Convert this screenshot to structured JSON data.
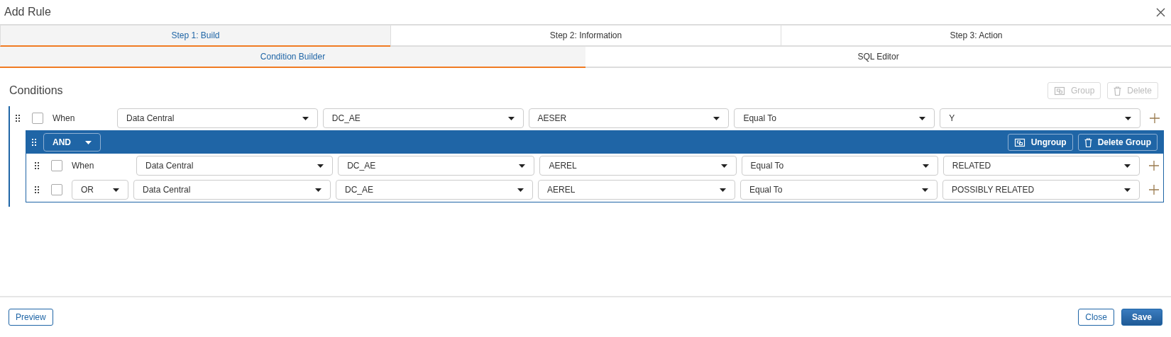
{
  "window": {
    "title": "Add Rule"
  },
  "steps": [
    {
      "label": "Step 1: Build",
      "selected": true
    },
    {
      "label": "Step 2: Information",
      "selected": false
    },
    {
      "label": "Step 3: Action",
      "selected": false
    }
  ],
  "sub_tabs": [
    {
      "label": "Condition Builder",
      "selected": true
    },
    {
      "label": "SQL Editor",
      "selected": false
    }
  ],
  "conditions": {
    "heading": "Conditions",
    "toolbar": [
      {
        "kind": "group",
        "label": "Group",
        "disabled": true
      },
      {
        "kind": "delete",
        "label": "Delete",
        "disabled": true
      }
    ],
    "rows": [
      {
        "checked": false,
        "connector": {
          "kind": "label",
          "text": "When"
        },
        "fields": [
          "Data Central",
          "DC_AE",
          "AESER",
          "Equal To",
          "Y"
        ]
      }
    ],
    "group": {
      "operator": "AND",
      "buttons": [
        {
          "kind": "ungroup",
          "label": "Ungroup"
        },
        {
          "kind": "delete",
          "label": "Delete Group"
        }
      ],
      "rows": [
        {
          "checked": false,
          "connector": {
            "kind": "label",
            "text": "When"
          },
          "fields": [
            "Data Central",
            "DC_AE",
            "AEREL",
            "Equal To",
            "RELATED"
          ]
        },
        {
          "checked": false,
          "connector": {
            "kind": "select",
            "text": "OR"
          },
          "fields": [
            "Data Central",
            "DC_AE",
            "AEREL",
            "Equal To",
            "POSSIBLY RELATED"
          ]
        }
      ]
    }
  },
  "footer": {
    "left": [
      {
        "label": "Preview",
        "kind": "outline"
      }
    ],
    "right": [
      {
        "label": "Close",
        "kind": "outline"
      },
      {
        "label": "Save",
        "kind": "primary"
      }
    ]
  }
}
